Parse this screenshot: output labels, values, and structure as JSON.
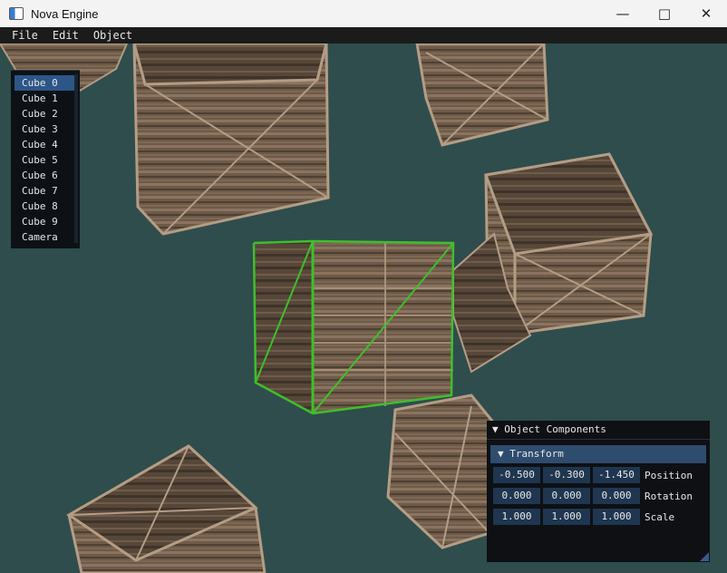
{
  "window": {
    "title": "Nova Engine"
  },
  "menu": [
    "File",
    "Edit",
    "Object"
  ],
  "scene_list": {
    "items": [
      "Cube 0",
      "Cube 1",
      "Cube 2",
      "Cube 3",
      "Cube 4",
      "Cube 5",
      "Cube 6",
      "Cube 7",
      "Cube 8",
      "Cube 9",
      "Camera"
    ],
    "selected": "Cube 0"
  },
  "components_panel": {
    "title": "▼ Object Components",
    "section": "▼  Transform",
    "rows": [
      {
        "label": "Position",
        "values": [
          "-0.500",
          "-0.300",
          "-1.450"
        ]
      },
      {
        "label": "Rotation",
        "values": [
          "0.000",
          "0.000",
          "0.000"
        ]
      },
      {
        "label": "Scale",
        "values": [
          "1.000",
          "1.000",
          "1.000"
        ]
      }
    ]
  },
  "colors": {
    "viewport_bg": "#2f4d4d",
    "selection_outline": "#3fbf2a",
    "selected_item": "#2d5688"
  }
}
